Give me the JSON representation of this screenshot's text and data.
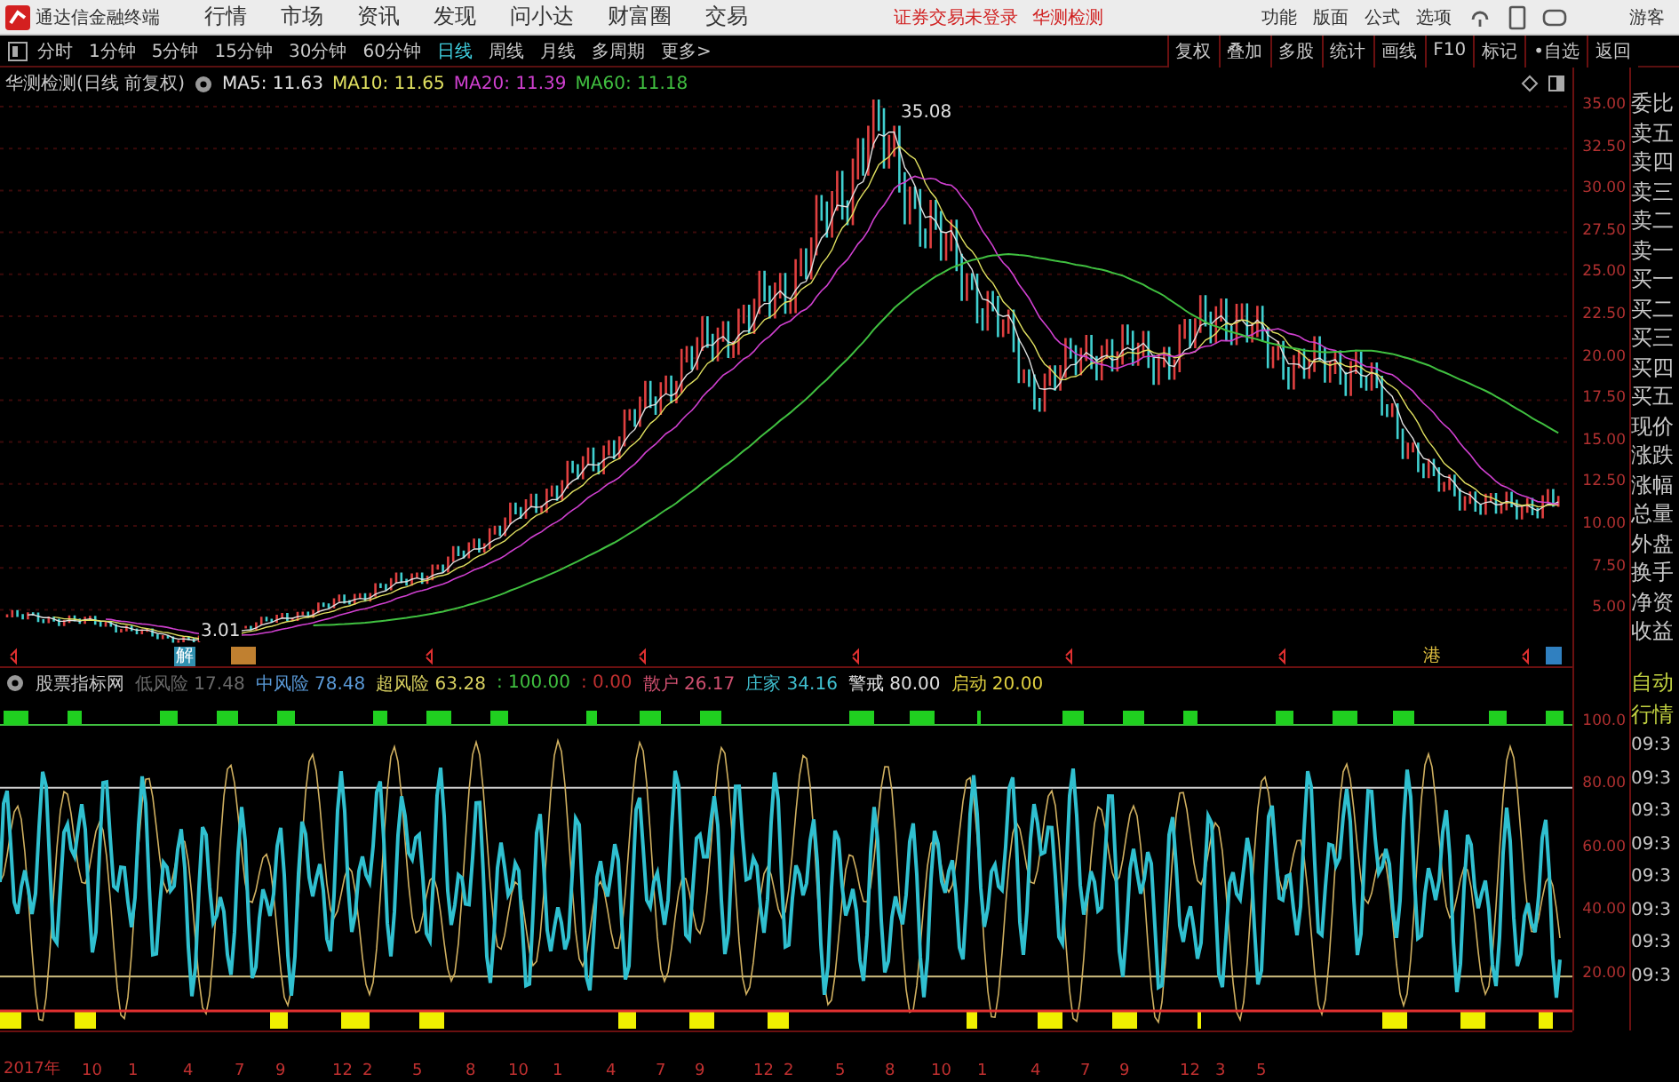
{
  "app": {
    "title": "通达信金融终端",
    "menus": [
      "行情",
      "市场",
      "资讯",
      "发现",
      "问小达",
      "财富圈",
      "交易"
    ],
    "notices": [
      "证券交易未登录",
      "华测检测"
    ],
    "tools": [
      "功能",
      "版面",
      "公式",
      "选项"
    ],
    "user": "游客"
  },
  "period_tabs": [
    {
      "label": "分时",
      "selected": false
    },
    {
      "label": "1分钟",
      "selected": false
    },
    {
      "label": "5分钟",
      "selected": false
    },
    {
      "label": "15分钟",
      "selected": false
    },
    {
      "label": "30分钟",
      "selected": false
    },
    {
      "label": "60分钟",
      "selected": false
    },
    {
      "label": "日线",
      "selected": true
    },
    {
      "label": "周线",
      "selected": false
    },
    {
      "label": "月线",
      "selected": false
    },
    {
      "label": "多周期",
      "selected": false
    },
    {
      "label": "更多>",
      "selected": false
    }
  ],
  "chart_buttons": [
    "复权",
    "叠加",
    "多股",
    "统计",
    "画线",
    "F10",
    "标记",
    "•自选",
    "返回"
  ],
  "main_chart": {
    "title": "华测检测(日线 前复权)",
    "ma": [
      {
        "label": "MA5: 11.63",
        "color": "#e0e0e0"
      },
      {
        "label": "MA10: 11.65",
        "color": "#e0e060"
      },
      {
        "label": "MA20: 11.39",
        "color": "#d040d0"
      },
      {
        "label": "MA60: 11.18",
        "color": "#40c040"
      }
    ],
    "high_label": "35.08",
    "low_label": "3.01",
    "event_labels": [
      "解",
      "港"
    ],
    "axis_labels": [
      "35.00",
      "32.50",
      "30.00",
      "27.50",
      "25.00",
      "22.50",
      "20.00",
      "17.50",
      "15.00",
      "12.50",
      "10.00",
      "7.50",
      "5.00"
    ]
  },
  "quote_labels": [
    "委比",
    "卖五",
    "卖四",
    "卖三",
    "卖二",
    "卖一",
    "买一",
    "买二",
    "买三",
    "买四",
    "买五",
    "现价",
    "涨跌",
    "涨幅",
    "总量",
    "外盘",
    "换手",
    "净资",
    "收益"
  ],
  "indicator": {
    "title": "股票指标网",
    "items": [
      {
        "label": "低风险",
        "value": "17.48",
        "color": "#6a6a6a"
      },
      {
        "label": "中风险",
        "value": "78.48",
        "color": "#5a9ad8"
      },
      {
        "label": "超风险",
        "value": "63.28",
        "color": "#d8d060"
      },
      {
        "value": ": 100.00",
        "color": "#40c040"
      },
      {
        "value": ": 0.00",
        "color": "#c03030"
      },
      {
        "label": "散户",
        "value": "26.17",
        "color": "#d05070"
      },
      {
        "label": "庄家",
        "value": "34.16",
        "color": "#40c0d0"
      },
      {
        "label": "警戒",
        "value": "80.00",
        "color": "#e0e0e0"
      },
      {
        "label": "启动",
        "value": "20.00",
        "color": "#e0d040"
      }
    ],
    "axis_labels": [
      "100.0",
      "80.00",
      "60.00",
      "40.00",
      "20.00"
    ]
  },
  "side_tabs": [
    "自动",
    "行情"
  ],
  "times": [
    "09:3",
    "09:3",
    "09:3",
    "09:3",
    "09:3",
    "09:3",
    "09:3",
    "09:3"
  ],
  "date_labels": [
    "2017年",
    "10",
    "1",
    "4",
    "7",
    "9",
    "12",
    "2",
    "5",
    "8",
    "10",
    "1",
    "4",
    "7",
    "9",
    "12",
    "2",
    "5",
    "8",
    "10",
    "1",
    "4",
    "7",
    "9",
    "12",
    "3",
    "5"
  ]
}
